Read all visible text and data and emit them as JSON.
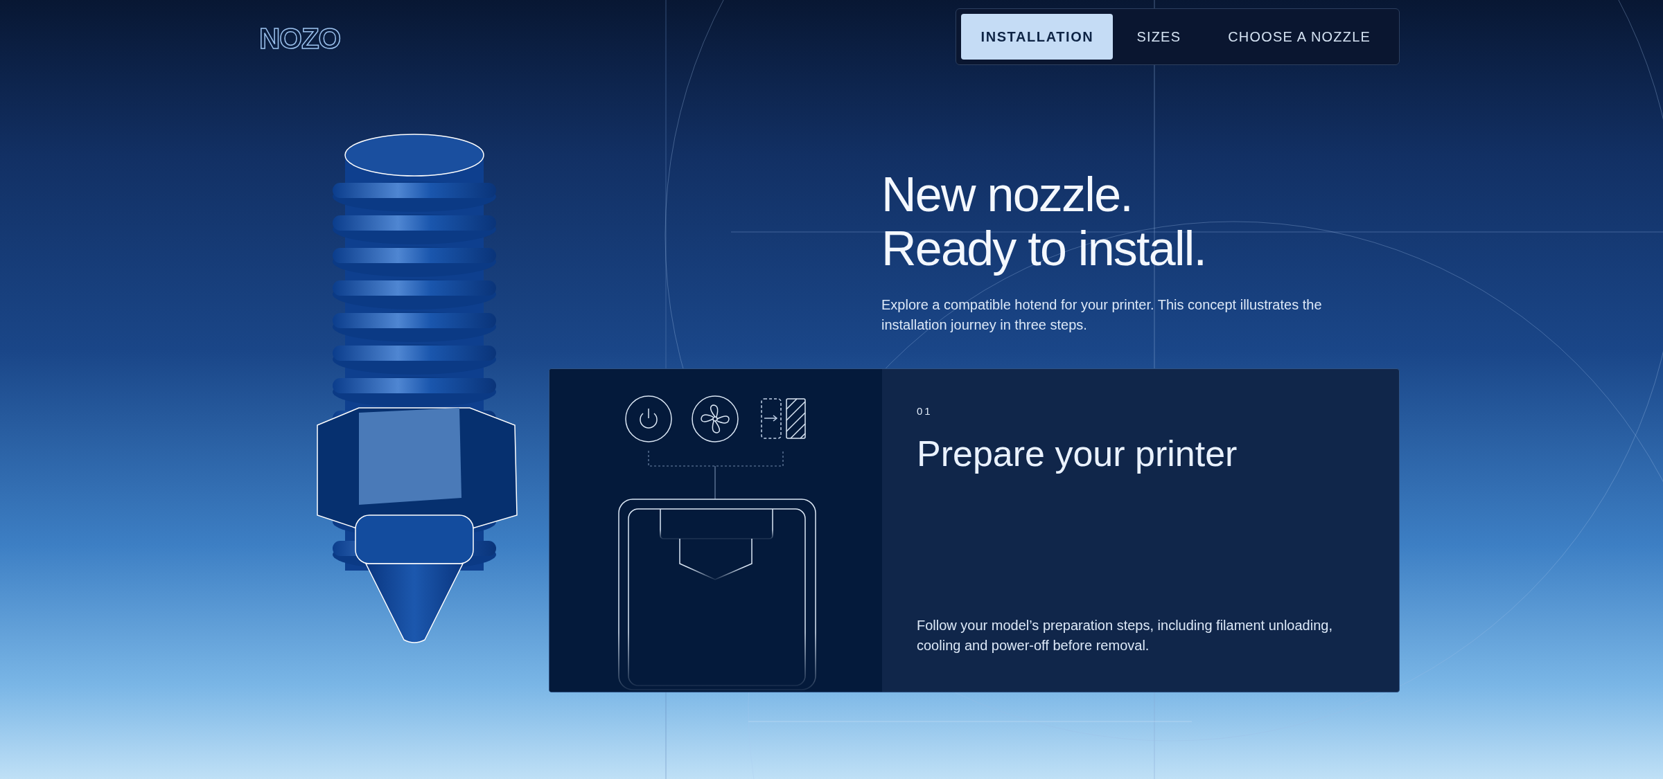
{
  "logo": "NOZO",
  "nav": [
    {
      "label": "INSTALLATION",
      "selected": true
    },
    {
      "label": "SIZES",
      "selected": false
    },
    {
      "label": "CHOOSE A NOZZLE",
      "selected": false
    }
  ],
  "hero": {
    "headline": [
      "New nozzle.",
      "Ready to install."
    ],
    "description": "Explore a compatible hotend for your printer. This concept illustrates the installation journey in three steps."
  },
  "step": {
    "number": "01",
    "title": "Prepare your printer",
    "description": "Follow your model’s preparation steps, including filament unloading, cooling and power-off before removal."
  }
}
